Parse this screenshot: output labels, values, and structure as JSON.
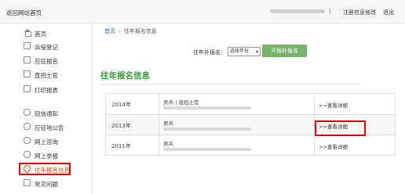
{
  "header": {
    "home_link": "返回网站首页",
    "separator": "|",
    "modify_link": "注册信息修改",
    "logout_link": "退出"
  },
  "sidebar": {
    "items": [
      {
        "label": "首页",
        "icon": "home-icon"
      },
      {
        "label": "兵役登记",
        "icon": "register-icon"
      },
      {
        "label": "应征报名",
        "icon": "form-icon"
      },
      {
        "label": "直招士官",
        "icon": "form-icon"
      },
      {
        "label": "打印报表",
        "icon": "print-icon"
      },
      {
        "label": "短信通知",
        "icon": "chat-icon"
      },
      {
        "label": "应征地公告",
        "icon": "chat-icon"
      },
      {
        "label": "网上咨询",
        "icon": "chat-icon"
      },
      {
        "label": "网上举报",
        "icon": "chat-icon"
      },
      {
        "label": "往年报名信息",
        "icon": "location-icon"
      },
      {
        "label": "常见问题",
        "icon": "help-icon"
      }
    ]
  },
  "breadcrumb": {
    "home": "首页",
    "arrow": "›",
    "current": "往年报名信息"
  },
  "supplement": {
    "label": "往年补报名：",
    "select_value": "选择年份",
    "button_label": "开始补报名"
  },
  "section_title": "往年报名信息",
  "records": [
    {
      "year": "2014年",
      "type": "男兵 | 直招士官",
      "action": ">>查看详细"
    },
    {
      "year": "2013年",
      "type": "男兵",
      "action": ">>查看详细"
    },
    {
      "year": "2011年",
      "type": "男兵",
      "action": ">>查看详细"
    }
  ],
  "colors": {
    "active": "#d04a1a",
    "highlight": "#e00000",
    "title_green": "#3c9a3c",
    "button_green": "#77b46a",
    "link_blue": "#2b6fb6"
  }
}
